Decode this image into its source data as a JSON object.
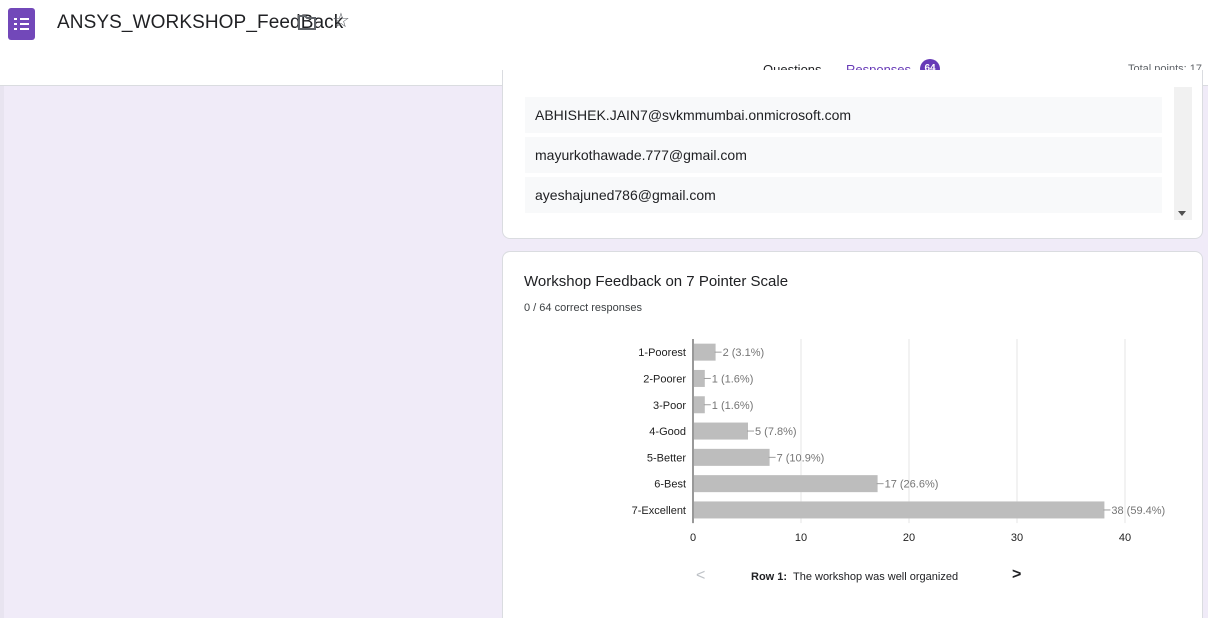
{
  "header": {
    "doc_title": "ANSYS_WORKSHOP_FeedBack",
    "tabs": [
      {
        "label": "Questions"
      },
      {
        "label": "Responses"
      }
    ],
    "responses_count": "64",
    "total_points": "Total points: 17"
  },
  "emails": [
    "ABHISHEK.JAIN7@svkmmumbai.onmicrosoft.com",
    "mayurkothawade.777@gmail.com",
    "ayeshajuned786@gmail.com"
  ],
  "question": {
    "title": "Workshop Feedback on 7 Pointer Scale",
    "correct_responses": "0 / 64 correct responses",
    "row_prefix": "Row 1:",
    "row_text": "The workshop was well organized"
  },
  "chart_data": {
    "type": "bar",
    "orientation": "horizontal",
    "categories": [
      "1-Poorest",
      "2-Poorer",
      "3-Poor",
      "4-Good",
      "5-Better",
      "6-Best",
      "7-Excellent"
    ],
    "values": [
      2,
      1,
      1,
      5,
      7,
      17,
      38
    ],
    "data_labels": [
      "2 (3.1%)",
      "1 (1.6%)",
      "1 (1.6%)",
      "5 (7.8%)",
      "7 (10.9%)",
      "17 (26.6%)",
      "38 (59.4%)"
    ],
    "xlim": [
      0,
      40
    ],
    "xticks": [
      0,
      10,
      20,
      30,
      40
    ],
    "grid": true,
    "bar_color": "#bdbdbd"
  },
  "icons": {
    "app": "forms-list-icon",
    "folder": "folder-icon",
    "star": "star-outline-icon",
    "prev": "chevron-left-icon",
    "next": "chevron-right-icon"
  },
  "colors": {
    "accent": "#673ab7",
    "background": "#f0ebf8"
  }
}
